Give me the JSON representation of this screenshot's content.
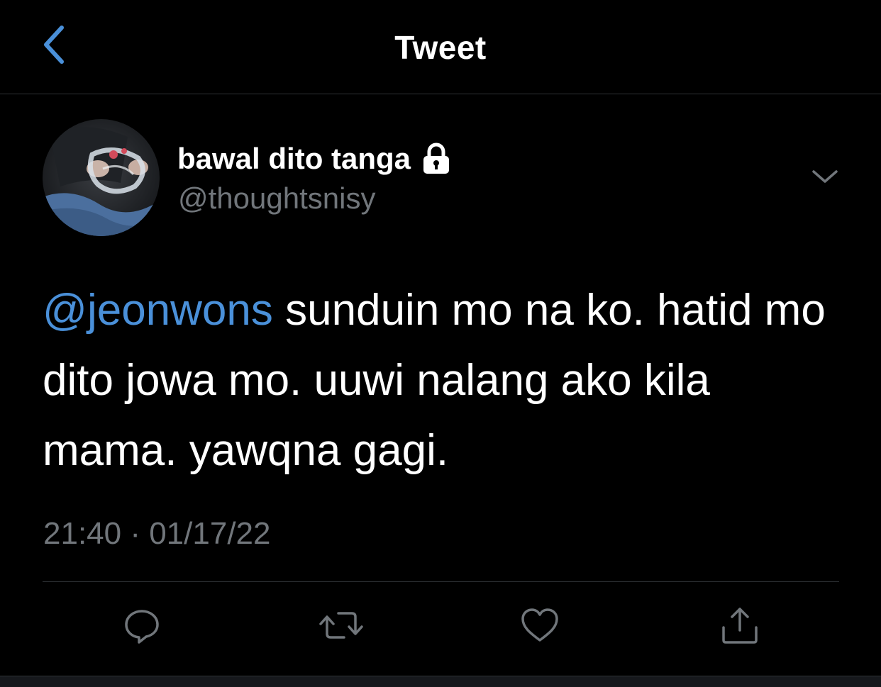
{
  "header": {
    "title": "Tweet",
    "back_icon": "chevron-left-icon"
  },
  "author": {
    "display_name": "bawal dito tanga",
    "handle": "@thoughtsnisy",
    "protected_icon": "lock-icon"
  },
  "tweet": {
    "mention": "@jeonwons",
    "text": " sunduin mo na ko. hatid mo dito jowa mo. uuwi nalang ako kila mama. yawqna gagi.",
    "timestamp": "21:40 · 01/17/22"
  },
  "actions": {
    "reply_icon": "reply-icon",
    "retweet_icon": "retweet-icon",
    "like_icon": "heart-icon",
    "share_icon": "share-icon"
  },
  "colors": {
    "background": "#000000",
    "accent": "#4a90d9",
    "secondary_text": "#71767b",
    "divider": "#2f3336"
  }
}
